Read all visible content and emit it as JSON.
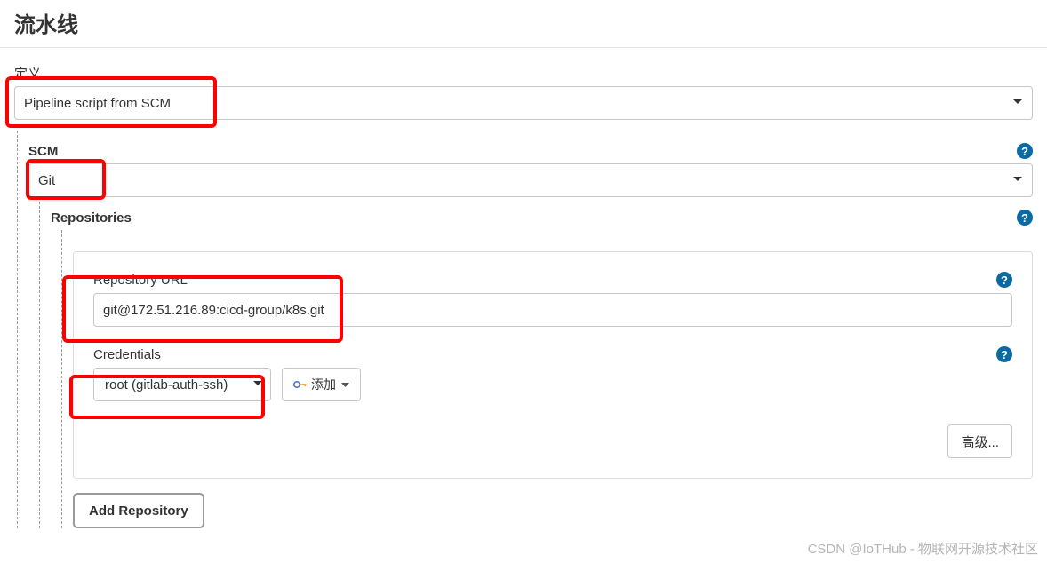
{
  "page": {
    "title": "流水线",
    "definition_label": "定义"
  },
  "definition_select": {
    "value": "Pipeline script from SCM"
  },
  "scm": {
    "label": "SCM",
    "value": "Git"
  },
  "repositories": {
    "label": "Repositories",
    "url_label": "Repository URL",
    "url_value": "git@172.51.216.89:cicd-group/k8s.git",
    "credentials_label": "Credentials",
    "credentials_value": "root (gitlab-auth-ssh)",
    "add_label": "添加",
    "advanced_label": "高级...",
    "add_repo_label": "Add Repository"
  },
  "help": {
    "glyph": "?"
  },
  "watermark": "CSDN @IoTHub - 物联网开源技术社区"
}
